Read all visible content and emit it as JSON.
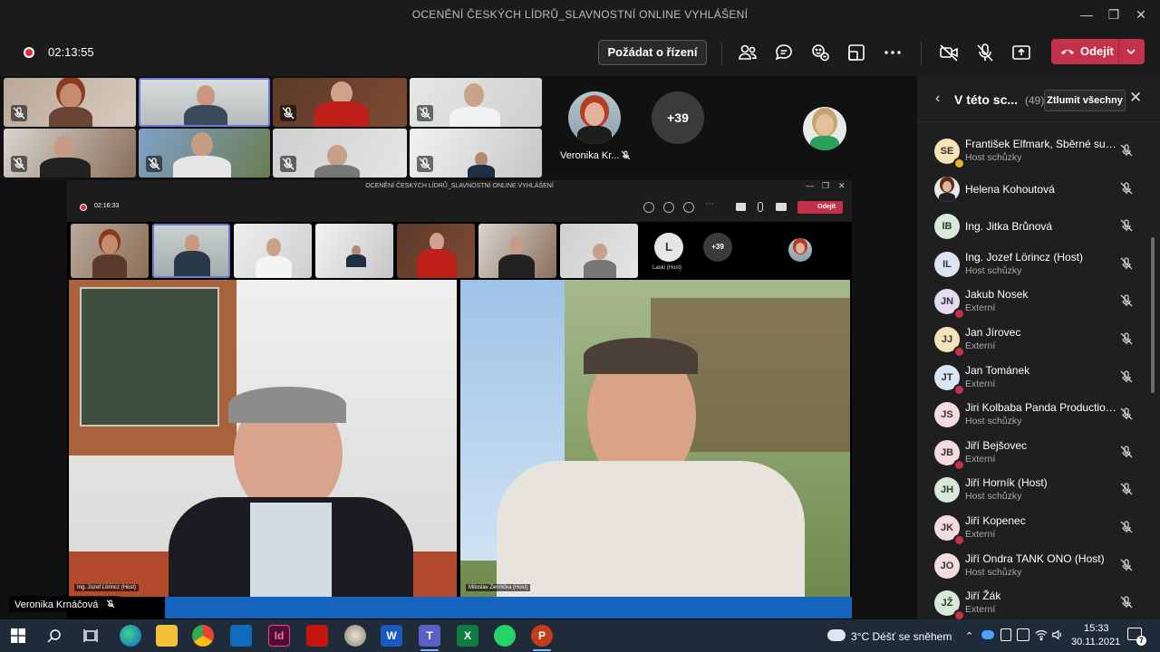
{
  "window": {
    "title": "OCENĚNÍ ČESKÝCH LÍDRŮ_SLAVNOSTNÍ ONLINE VYHLÁŠENÍ"
  },
  "toolbar": {
    "timer": "02:13:55",
    "request_control_label": "Požádat o řízení",
    "leave_label": "Odejít"
  },
  "gallery": {
    "featured_name": "Veronika Kr...",
    "overflow_count": "+39"
  },
  "inner_meeting": {
    "title": "OCENĚNÍ ČESKÝCH LÍDRŮ_SLAVNOSTNÍ ONLINE VYHLÁŠENÍ",
    "timer": "02:16:33",
    "leave_label": "Odejít",
    "avatar_letter": "L",
    "avatar_name": "Laski (Host)",
    "overflow_count": "+39",
    "left_name": "Ing. Jozef Lörincz (Host)",
    "right_name": "Miloslav Zemlička (Host)"
  },
  "bottom_name": "Veronika Krnáčová",
  "panel": {
    "title": "V této sc...",
    "count": "(49)",
    "mute_all_label": "Ztlumit všechny",
    "participants": [
      {
        "initials": "SE",
        "name": "František Elfmark, Sběrné sur...",
        "role": "Host schůzky",
        "avatar_color": "#f4e2b8",
        "status_color": "#e8b230"
      },
      {
        "initials": "",
        "name": "Helena Kohoutová",
        "role": "",
        "avatar_color": "#6b3a2a",
        "status_color": ""
      },
      {
        "initials": "IB",
        "name": "Ing. Jitka Brůnová",
        "role": "",
        "avatar_color": "#d7e9d9",
        "status_color": ""
      },
      {
        "initials": "IL",
        "name": "Ing. Jozef Lörincz (Host)",
        "role": "Host schůzky",
        "avatar_color": "#dbe4f3",
        "status_color": ""
      },
      {
        "initials": "JN",
        "name": "Jakub Nosek",
        "role": "Externí",
        "avatar_color": "#e3dbf0",
        "status_color": "#c4314b"
      },
      {
        "initials": "JJ",
        "name": "Jan Jírovec",
        "role": "Externí",
        "avatar_color": "#f4e2b8",
        "status_color": "#c4314b"
      },
      {
        "initials": "JT",
        "name": "Jan Tománek",
        "role": "Externí",
        "avatar_color": "#d9e6f6",
        "status_color": "#c4314b"
      },
      {
        "initials": "JS",
        "name": "Jiri Kolbaba Panda Production...",
        "role": "Host schůzky",
        "avatar_color": "#f3dbe0",
        "status_color": ""
      },
      {
        "initials": "JB",
        "name": "Jiří Bejšovec",
        "role": "Externí",
        "avatar_color": "#f3dbe0",
        "status_color": "#c4314b"
      },
      {
        "initials": "JH",
        "name": "Jiří Horník (Host)",
        "role": "Host schůzky",
        "avatar_color": "#d7e9d9",
        "status_color": ""
      },
      {
        "initials": "JK",
        "name": "Jiří Kopenec",
        "role": "Externí",
        "avatar_color": "#f3dbe0",
        "status_color": "#c4314b"
      },
      {
        "initials": "JO",
        "name": "Jiří Ondra TANK ONO (Host)",
        "role": "Host schůzky",
        "avatar_color": "#f3dbe0",
        "status_color": ""
      },
      {
        "initials": "JŽ",
        "name": "Jiří Žák",
        "role": "Externí",
        "avatar_color": "#d7e9d9",
        "status_color": "#c4314b"
      }
    ]
  },
  "taskbar": {
    "weather": "3°C  Déšť se sněhem",
    "time": "15:33",
    "date": "30.11.2021",
    "notification_count": "7"
  },
  "colors": {
    "leave": "#c4314b",
    "panel_bg": "#1f1f1f",
    "taskbar": "#202b3a"
  }
}
